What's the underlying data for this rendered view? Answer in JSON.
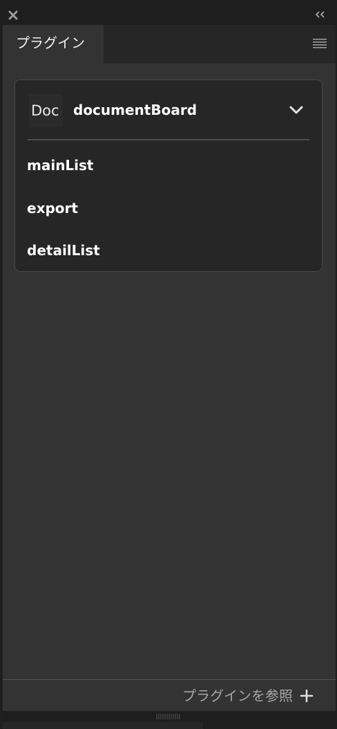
{
  "window": {
    "close_icon": "close-icon",
    "collapse_icon": "double-chevron-left-icon"
  },
  "tabs": [
    {
      "label": "プラグイン",
      "active": true
    }
  ],
  "panel_menu_icon": "hamburger-menu-icon",
  "document_card": {
    "badge": "Doc",
    "title": "documentBoard",
    "expand_icon": "chevron-down-icon",
    "items": [
      {
        "label": "mainList"
      },
      {
        "label": "export"
      },
      {
        "label": "detailList"
      }
    ]
  },
  "footer": {
    "browse_label": "プラグインを参照",
    "add_icon": "plus-icon"
  },
  "colors": {
    "panel_bg": "#333333",
    "card_bg": "#262626",
    "card_border": "#4a4a4a",
    "text_primary": "#ffffff",
    "text_muted": "#a6a6a6"
  }
}
